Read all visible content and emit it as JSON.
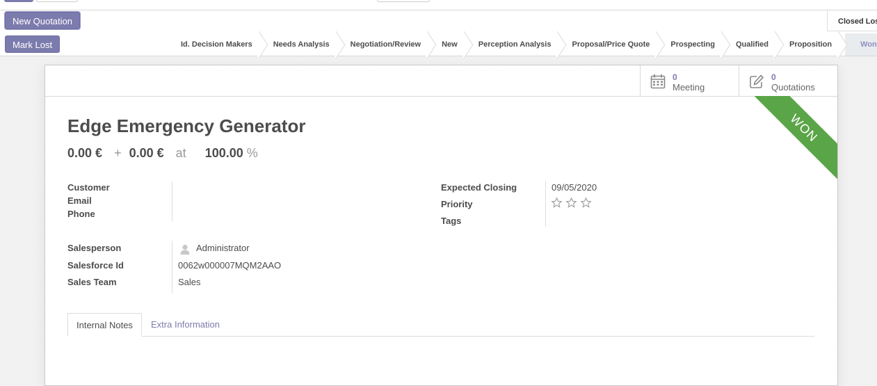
{
  "actions": {
    "new_quotation": "New Quotation",
    "mark_lost": "Mark Lost"
  },
  "statusbar": {
    "folded_stage": "Closed Lost",
    "stages": [
      "Id. Decision Makers",
      "Needs Analysis",
      "Negotiation/Review",
      "New",
      "Perception Analysis",
      "Proposal/Price Quote",
      "Prospecting",
      "Qualified",
      "Proposition"
    ],
    "current_stage": "Won"
  },
  "smart_buttons": {
    "meeting": {
      "value": "0",
      "label": "Meeting",
      "icon": "calendar-icon"
    },
    "quotations": {
      "value": "0",
      "label": "Quotations",
      "icon": "edit-icon"
    }
  },
  "ribbon": "WON",
  "record": {
    "name": "Edge Emergency Generator",
    "expected_revenue": "0.00 €",
    "plus": "+",
    "prorated_revenue": "0.00 €",
    "at": "at",
    "probability": "100.00",
    "percent": "%"
  },
  "fields": {
    "customer_label": "Customer",
    "email_label": "Email",
    "phone_label": "Phone",
    "expected_closing_label": "Expected Closing",
    "expected_closing": "09/05/2020",
    "priority_label": "Priority",
    "priority_stars": 0,
    "priority_max": 3,
    "tags_label": "Tags",
    "salesperson_label": "Salesperson",
    "salesperson": "Administrator",
    "salesforce_id_label": "Salesforce Id",
    "salesforce_id": "0062w000007MQM2AAO",
    "sales_team_label": "Sales Team",
    "sales_team": "Sales"
  },
  "tabs": {
    "internal_notes": "Internal Notes",
    "extra_information": "Extra Information"
  },
  "colors": {
    "brand": "#7c7bad",
    "won_ribbon": "#5aa547"
  }
}
